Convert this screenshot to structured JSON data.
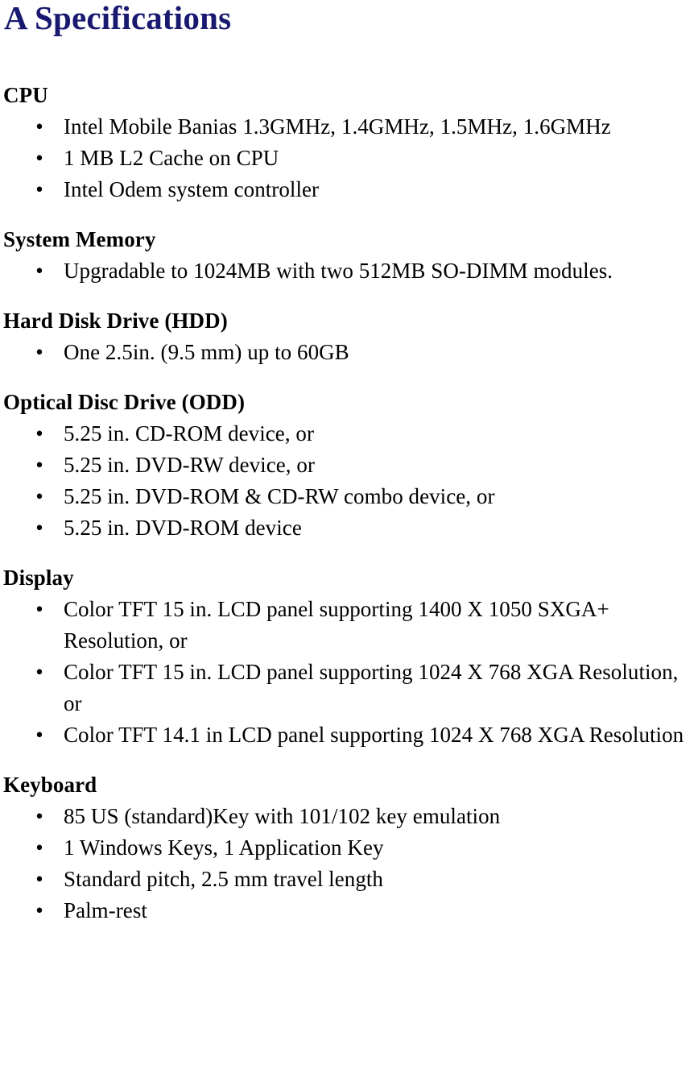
{
  "document": {
    "title": "A Specifications",
    "title_color": "#191970",
    "body_color": "#000000",
    "background_color": "#ffffff",
    "bullet_glyph": "•",
    "bullet_icon_name": "disc-bullet-icon"
  },
  "sections": [
    {
      "heading": "CPU",
      "items": [
        "Intel Mobile Banias 1.3GMHz, 1.4GMHz, 1.5MHz, 1.6GMHz",
        "1 MB L2 Cache on CPU",
        "Intel Odem system controller"
      ]
    },
    {
      "heading": "System Memory",
      "items": [
        "Upgradable to 1024MB with two 512MB SO-DIMM modules."
      ]
    },
    {
      "heading": "Hard Disk Drive (HDD)",
      "items": [
        "One 2.5in. (9.5 mm) up to 60GB"
      ]
    },
    {
      "heading": "Optical Disc Drive (ODD)",
      "items": [
        "5.25 in. CD-ROM device, or",
        "5.25 in. DVD-RW device, or",
        "5.25 in. DVD-ROM & CD-RW combo device, or",
        "5.25 in. DVD-ROM device"
      ]
    },
    {
      "heading": "Display",
      "items": [
        "Color TFT 15 in. LCD panel supporting 1400 X 1050 SXGA+ Resolution, or",
        "Color TFT 15 in. LCD panel supporting 1024 X 768 XGA Resolution, or",
        "Color TFT 14.1 in LCD panel supporting 1024 X 768 XGA Resolution"
      ]
    },
    {
      "heading": "Keyboard",
      "items": [
        "85 US (standard)Key with 101/102 key emulation",
        "1 Windows Keys, 1 Application Key",
        "Standard pitch, 2.5 mm travel length",
        "Palm-rest"
      ]
    }
  ]
}
